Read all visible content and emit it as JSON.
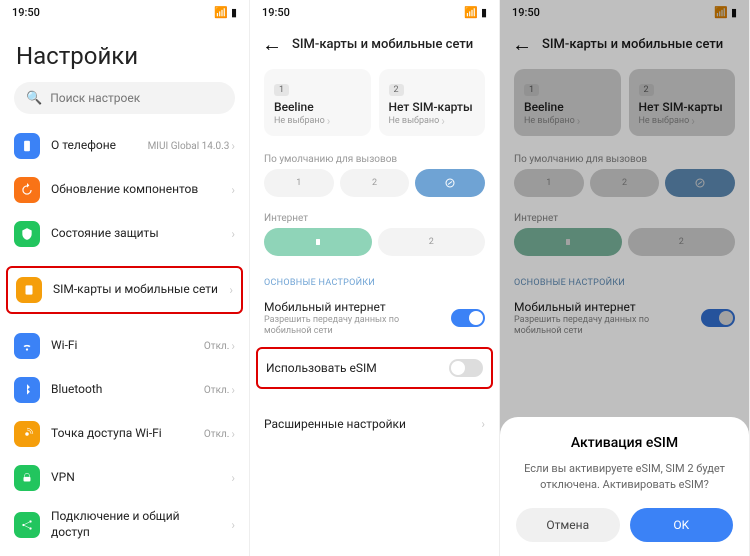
{
  "statusbar": {
    "time": "19:50"
  },
  "screen1": {
    "title": "Настройки",
    "search_placeholder": "Поиск настроек",
    "items": [
      {
        "label": "О телефоне",
        "value": "MIUI Global 14.0.3",
        "color": "#3b82f6"
      },
      {
        "label": "Обновление компонентов",
        "value": "",
        "color": "#f97316"
      },
      {
        "label": "Состояние защиты",
        "value": "",
        "color": "#22c55e"
      },
      {
        "label": "SIM-карты и мобильные сети",
        "value": "",
        "color": "#f59e0b",
        "highlight": true
      },
      {
        "label": "Wi-Fi",
        "value": "Откл.",
        "color": "#3b82f6"
      },
      {
        "label": "Bluetooth",
        "value": "Откл.",
        "color": "#3b82f6"
      },
      {
        "label": "Точка доступа Wi-Fi",
        "value": "Откл.",
        "color": "#f59e0b"
      },
      {
        "label": "VPN",
        "value": "",
        "color": "#22c55e"
      },
      {
        "label": "Подключение и общий доступ",
        "value": "",
        "color": "#22c55e"
      }
    ]
  },
  "screen2": {
    "title": "SIM-карты и мобильные сети",
    "sim1": {
      "badge": "1",
      "name": "Beeline",
      "sub": "Не выбрано"
    },
    "sim2": {
      "badge": "2",
      "name": "Нет SIM-карты",
      "sub": "Не выбрано"
    },
    "default_calls": "По умолчанию для вызовов",
    "internet": "Интернет",
    "main_settings": "ОСНОВНЫЕ НАСТРОЙКИ",
    "mobile_internet": {
      "title": "Мобильный интернет",
      "sub": "Разрешить передачу данных по мобильной сети"
    },
    "use_esim": "Использовать eSIM",
    "advanced": "Расширенные настройки"
  },
  "screen3": {
    "dialog": {
      "title": "Активация eSIM",
      "body": "Если вы активируете eSIM, SIM 2 будет отключена.\nАктивировать eSIM?",
      "cancel": "Отмена",
      "ok": "OK"
    }
  }
}
